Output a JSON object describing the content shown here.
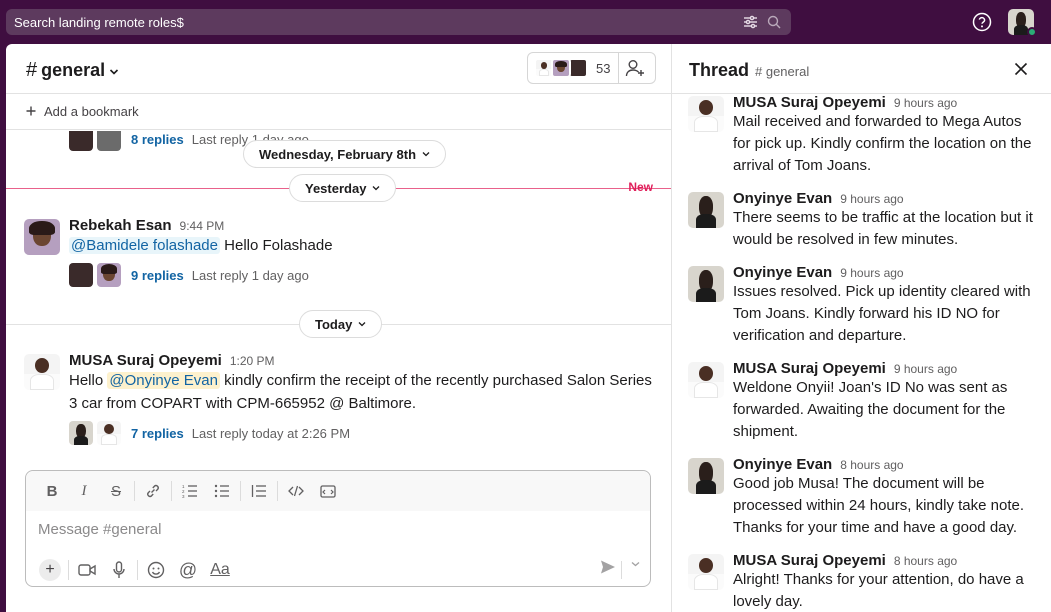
{
  "search": {
    "text": "Search landing remote roles$"
  },
  "channel": {
    "name": "general",
    "member_count": "53"
  },
  "bookmark": {
    "label": "Add a bookmark"
  },
  "thread_preview_top": {
    "replies": "8 replies",
    "last": "Last reply 1 day ago"
  },
  "dates": {
    "feb": "Wednesday, February 8th",
    "yesterday": "Yesterday",
    "today": "Today",
    "new_label": "New"
  },
  "messages": [
    {
      "author": "Rebekah Esan",
      "time": "9:44 PM",
      "mention": "@Bamidele folashade",
      "text": " Hello Folashade",
      "replies": "9 replies",
      "last": "Last reply 1 day ago"
    },
    {
      "author": "MUSA Suraj Opeyemi",
      "time": "1:20 PM",
      "prefix": "Hello ",
      "mention": "@Onyinye Evan",
      "text": " kindly confirm the receipt of the recently purchased Salon Series 3 car from COPART with CPM-665952 @ Baltimore.",
      "replies": "7 replies",
      "last": "Last reply today at 2:26 PM"
    }
  ],
  "composer": {
    "placeholder": "Message #general"
  },
  "thread": {
    "title": "Thread",
    "channel": "# general",
    "messages": [
      {
        "author": "MUSA Suraj Opeyemi",
        "time": "9 hours ago",
        "text": "Mail received and forwarded to Mega Autos for pick up. Kindly confirm the location on the arrival of Tom Joans."
      },
      {
        "author": "Onyinye Evan",
        "time": "9 hours ago",
        "text": "There seems to be traffic at the location but it would be resolved in few minutes."
      },
      {
        "author": "Onyinye Evan",
        "time": "9 hours ago",
        "text": "Issues resolved. Pick up identity cleared with Tom Joans. Kindly forward his ID NO for verification and departure."
      },
      {
        "author": "MUSA Suraj Opeyemi",
        "time": "9 hours ago",
        "text": "Weldone Onyii! Joan's ID No was sent as forwarded. Awaiting the document for the shipment."
      },
      {
        "author": "Onyinye Evan",
        "time": "8 hours ago",
        "text": "Good job Musa! The document will be processed within 24 hours, kindly take note. Thanks for your time and have a good day."
      },
      {
        "author": "MUSA Suraj Opeyemi",
        "time": "8 hours ago",
        "text": "Alright! Thanks for your attention, do have a lovely day."
      }
    ]
  },
  "colors": {
    "aubergine": "#3f0e40",
    "link": "#1264a3",
    "new": "#e01e5a",
    "presence": "#2bac76"
  },
  "icons": [
    "filter-icon",
    "search-icon",
    "help-icon",
    "chevron-down-icon",
    "add-member-icon",
    "plus-icon",
    "close-icon",
    "bold-icon",
    "italic-icon",
    "strike-icon",
    "link-icon",
    "ordered-list-icon",
    "bullet-list-icon",
    "blockquote-icon",
    "code-icon",
    "code-block-icon",
    "video-icon",
    "mic-icon",
    "emoji-icon",
    "mention-icon",
    "format-icon",
    "send-icon"
  ]
}
